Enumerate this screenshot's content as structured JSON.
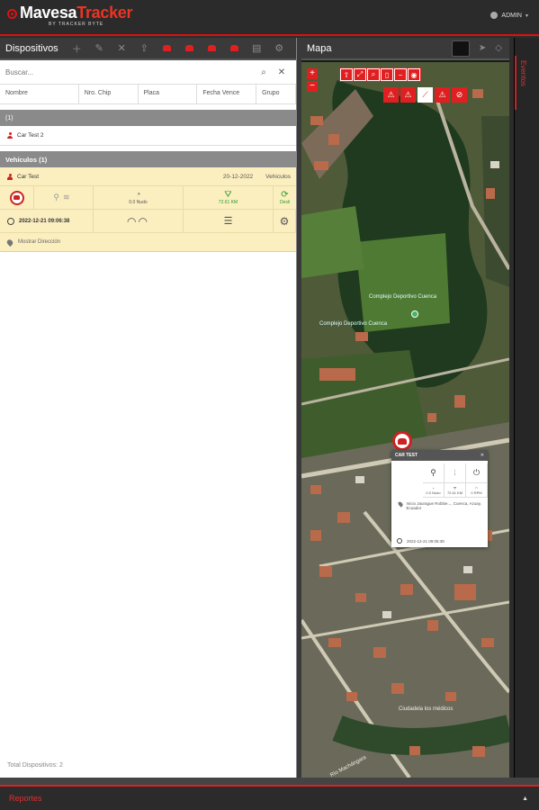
{
  "header": {
    "brand_main": "Mavesa",
    "brand_accent": "Tracker",
    "brand_sub": "BY TRACKER BYTE",
    "user": "ADMIN",
    "accent_color": "#e02020"
  },
  "devices": {
    "title": "Dispositivos",
    "search_placeholder": "Buscar...",
    "columns": [
      "Nombre",
      "Nro. Chip",
      "Placa",
      "Fecha Vence",
      "Grupo"
    ],
    "group1": {
      "label": "(1)"
    },
    "group1_item": "Car Test 2",
    "group2": {
      "label": "Vehículos (1)"
    },
    "card": {
      "name": "Car Test",
      "date": "20-12-2022",
      "group": "Vehiculos",
      "speed": "0.0 Nudo",
      "odometer": "72.61 KM",
      "status": "Desli",
      "timestamp": "2022-12-21 09:06:38",
      "show_address": "Mostrar Dirección"
    },
    "total": "Total Dispositivos: 2"
  },
  "map": {
    "title": "Mapa",
    "poi_name": "Complejo Deportivo Cuenca",
    "poi_left": "Complejo Deportivo Cuenca",
    "place_label": "Ciudadela los médicos",
    "river_label": "Río Machángara",
    "popup": {
      "name": "CAR TEST",
      "speed": "0.0 Nudo",
      "odometer": "72.61 KM",
      "rpm": "0 RPM",
      "address": "Inicio Jaurague Robbie..., Cuenca, Azuay, Ecuador",
      "time": "2022-12-21 09:06:38"
    }
  },
  "events": {
    "label": "Eventos"
  },
  "reports": {
    "label": "Reportes"
  }
}
